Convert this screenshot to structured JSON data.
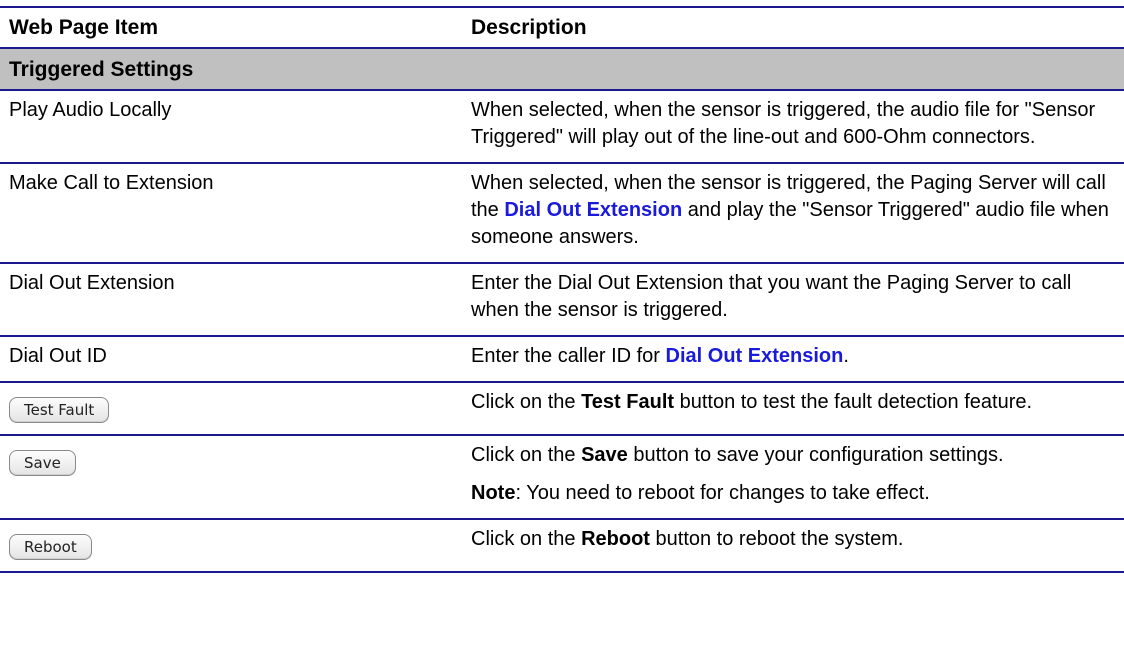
{
  "table": {
    "header": {
      "item": "Web Page Item",
      "description": "Description"
    },
    "section": "Triggered Settings",
    "rows": [
      {
        "item": "Play Audio Locally",
        "description": "When selected, when the sensor is triggered, the audio file for \"Sensor Triggered\" will play out of the line-out and 600-Ohm connectors."
      },
      {
        "item": "Make Call to Extension",
        "desc_pre": "When selected, when the sensor is triggered, the Paging Server will call the ",
        "desc_link": "Dial Out Extension",
        "desc_post": " and play the \"Sensor Triggered\" audio file when someone answers."
      },
      {
        "item": "Dial Out Extension",
        "description": "Enter the Dial Out Extension that you want the Paging Server to call when the sensor is triggered."
      },
      {
        "item": "Dial Out ID",
        "desc_pre": "Enter the caller ID for ",
        "desc_link": "Dial Out Extension",
        "desc_post": "."
      }
    ],
    "buttons": [
      {
        "label": "Test Fault",
        "desc_pre": "Click on the ",
        "desc_bold": "Test Fault",
        "desc_post": " button to test the fault detection feature."
      },
      {
        "label": "Save",
        "desc_pre": "Click on the ",
        "desc_bold": "Save",
        "desc_post": " button to save your configuration settings.",
        "note_bold": "Note",
        "note_text": ": You need to reboot for changes to take effect."
      },
      {
        "label": "Reboot",
        "desc_pre": "Click on the ",
        "desc_bold": "Reboot",
        "desc_post": " button to reboot the system."
      }
    ]
  }
}
